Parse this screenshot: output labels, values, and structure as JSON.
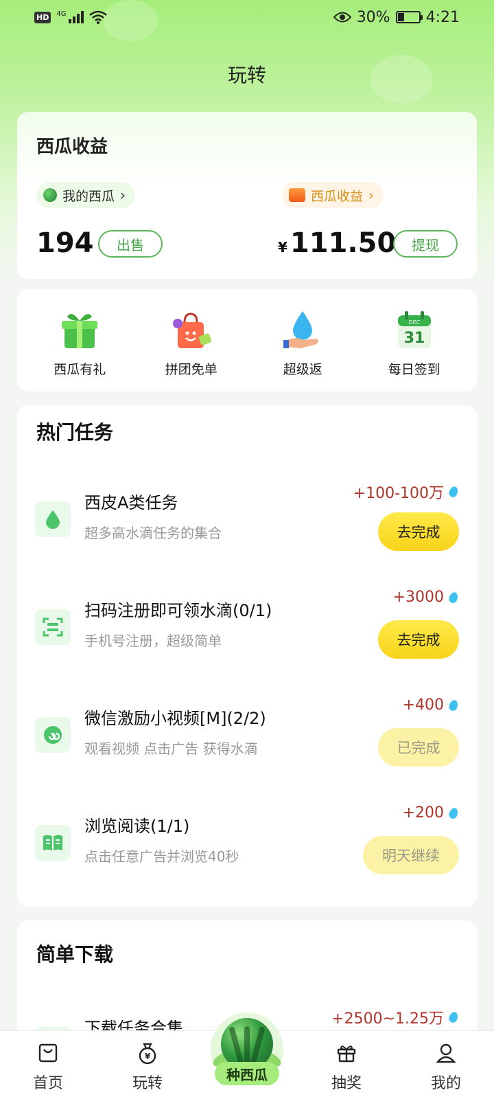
{
  "status_bar": {
    "hd": "HD",
    "network": "4G",
    "battery_percent": "30%",
    "time": "4:21"
  },
  "header": {
    "title": "玩转"
  },
  "earnings": {
    "title": "西瓜收益",
    "my_melon_label": "我的西瓜",
    "melon_income_label": "西瓜收益",
    "melon_count": "194",
    "sell_label": "出售",
    "currency": "¥",
    "income_amount": "111.50",
    "withdraw_label": "提现"
  },
  "quick_actions": [
    {
      "label": "西瓜有礼",
      "icon": "gift-box-icon"
    },
    {
      "label": "拼团免单",
      "icon": "shopping-bag-icon"
    },
    {
      "label": "超级返",
      "icon": "water-drop-hand-icon"
    },
    {
      "label": "每日签到",
      "icon": "calendar-icon",
      "calendar_month": "DEC",
      "calendar_day": "31"
    }
  ],
  "hot_tasks": {
    "title": "热门任务",
    "items": [
      {
        "name": "西皮A类任务",
        "desc": "超多高水滴任务的集合",
        "reward": "+100-100万",
        "button": "去完成",
        "state": "go",
        "icon": "water-drop-icon"
      },
      {
        "name": "扫码注册即可领水滴(0/1)",
        "desc": "手机号注册，超级简单",
        "reward": "+3000",
        "button": "去完成",
        "state": "go",
        "icon": "scan-icon"
      },
      {
        "name": "微信激励小视频[M](2/2)",
        "desc": "观看视频 点击广告 获得水滴",
        "reward": "+400",
        "button": "已完成",
        "state": "done",
        "icon": "mini-program-icon"
      },
      {
        "name": "浏览阅读(1/1)",
        "desc": "点击任意广告并浏览40秒",
        "reward": "+200",
        "button": "明天继续",
        "state": "tomorrow",
        "icon": "book-icon"
      }
    ]
  },
  "downloads": {
    "title": "简单下载",
    "items": [
      {
        "name": "下载任务合集",
        "reward": "+2500~1.25万"
      }
    ]
  },
  "bottom_nav": {
    "items": [
      {
        "label": "首页",
        "icon": "home-bag-icon"
      },
      {
        "label": "玩转",
        "icon": "money-bag-icon"
      },
      {
        "label": "抽奖",
        "icon": "gift-icon"
      },
      {
        "label": "我的",
        "icon": "user-icon"
      }
    ],
    "center_label": "种西瓜"
  },
  "colors": {
    "brand_green": "#a6ee7b",
    "accent_yellow": "#f8d419",
    "reward_red": "#b0342a",
    "outline_green": "#5bb55a"
  }
}
